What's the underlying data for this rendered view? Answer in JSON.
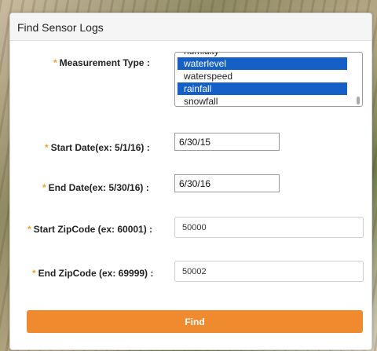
{
  "panel": {
    "title": "Find Sensor Logs"
  },
  "form": {
    "measurement_type": {
      "label": "Measurement Type :",
      "options": [
        {
          "text": "humidity",
          "selected": false
        },
        {
          "text": "waterlevel",
          "selected": true
        },
        {
          "text": "waterspeed",
          "selected": false
        },
        {
          "text": "rainfall",
          "selected": true
        },
        {
          "text": "snowfall",
          "selected": false
        }
      ]
    },
    "start_date": {
      "label": "Start Date(ex: 5/1/16) :",
      "value": "6/30/15"
    },
    "end_date": {
      "label": "End Date(ex: 5/30/16) :",
      "value": "6/30/16"
    },
    "start_zip": {
      "label": "Start ZipCode (ex: 60001) :",
      "value": "50000"
    },
    "end_zip": {
      "label": "End ZipCode (ex: 69999) :",
      "value": "50002"
    },
    "required_marker": "*",
    "find_button": "Find"
  },
  "colors": {
    "accent": "#ef8a2f",
    "selection": "#1560c7",
    "required": "#f0a028"
  }
}
